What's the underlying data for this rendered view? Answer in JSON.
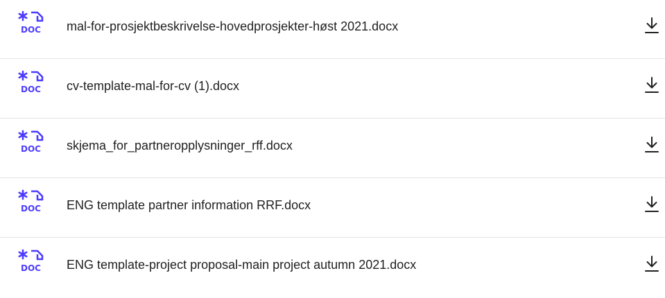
{
  "files": [
    {
      "name": "mal-for-prosjektbeskrivelse-hovedprosjekter-høst 2021.docx",
      "icon": "doc-file-icon",
      "action_icon": "download-icon"
    },
    {
      "name": "cv-template-mal-for-cv (1).docx",
      "icon": "doc-file-icon",
      "action_icon": "download-icon"
    },
    {
      "name": "skjema_for_partneropplysninger_rff.docx",
      "icon": "doc-file-icon",
      "action_icon": "download-icon"
    },
    {
      "name": "ENG template partner information RRF.docx",
      "icon": "doc-file-icon",
      "action_icon": "download-icon"
    },
    {
      "name": "ENG template-project proposal-main project autumn 2021.docx",
      "icon": "doc-file-icon",
      "action_icon": "download-icon"
    }
  ],
  "icon_label": "DOC",
  "colors": {
    "accent": "#4b3aff",
    "text": "#1f1f1f",
    "divider": "#e3e3e3",
    "background": "#ffffff"
  }
}
